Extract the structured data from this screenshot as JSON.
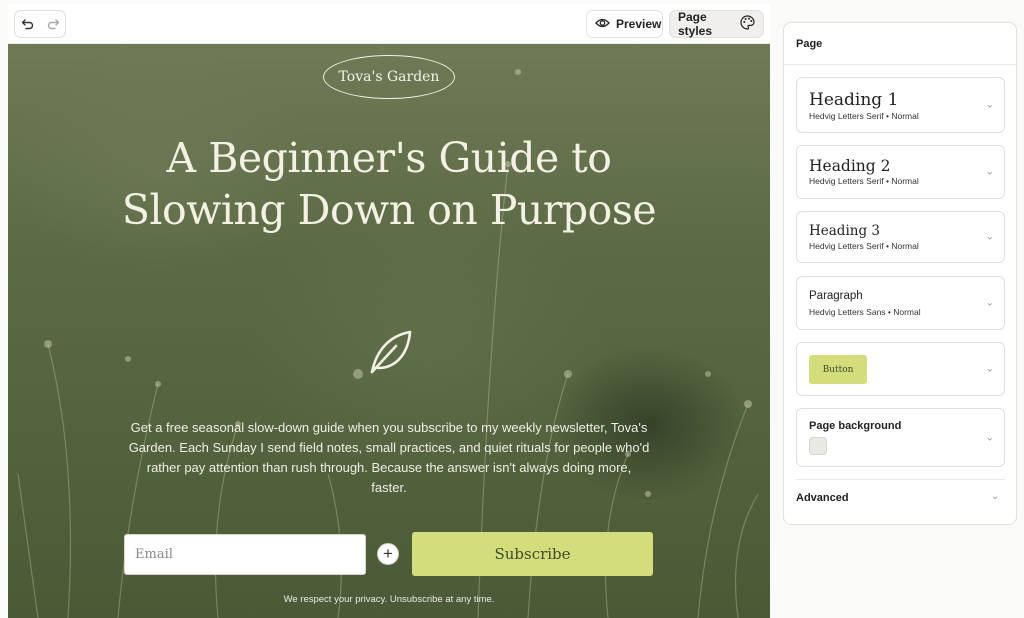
{
  "toolbar": {
    "preview_label": "Preview",
    "page_styles_label": "Page styles"
  },
  "canvas": {
    "brand": "Tova's Garden",
    "title": "A Beginner's Guide to Slowing Down on Purpose",
    "body": "Get a free seasonal slow-down guide when you subscribe to my weekly newsletter, Tova's Garden. Each Sunday I send field notes, small practices, and quiet rituals for people who'd rather pay attention than rush through. Because the answer isn't always doing more, faster.",
    "email_placeholder": "Email",
    "plus": "+",
    "subscribe_label": "Subscribe",
    "privacy": "We respect your privacy. Unsubscribe at any time."
  },
  "panel": {
    "title": "Page",
    "heading1": {
      "name": "Heading 1",
      "meta": "Hedvig Letters Serif • Normal"
    },
    "heading2": {
      "name": "Heading 2",
      "meta": "Hedvig Letters Serif • Normal"
    },
    "heading3": {
      "name": "Heading 3",
      "meta": "Hedvig Letters Serif • Normal"
    },
    "paragraph": {
      "name": "Paragraph",
      "meta": "Hedvig Letters Sans • Normal"
    },
    "button_label": "Button",
    "page_background_label": "Page background",
    "advanced_label": "Advanced"
  },
  "colors": {
    "accent": "#d3dd7a",
    "canvas_bg": "#5c6b45",
    "text_light": "#f3f0e4"
  },
  "icons": [
    "undo-icon",
    "redo-icon",
    "eye-icon",
    "palette-icon",
    "leaf-icon",
    "chevron-down-icon"
  ]
}
